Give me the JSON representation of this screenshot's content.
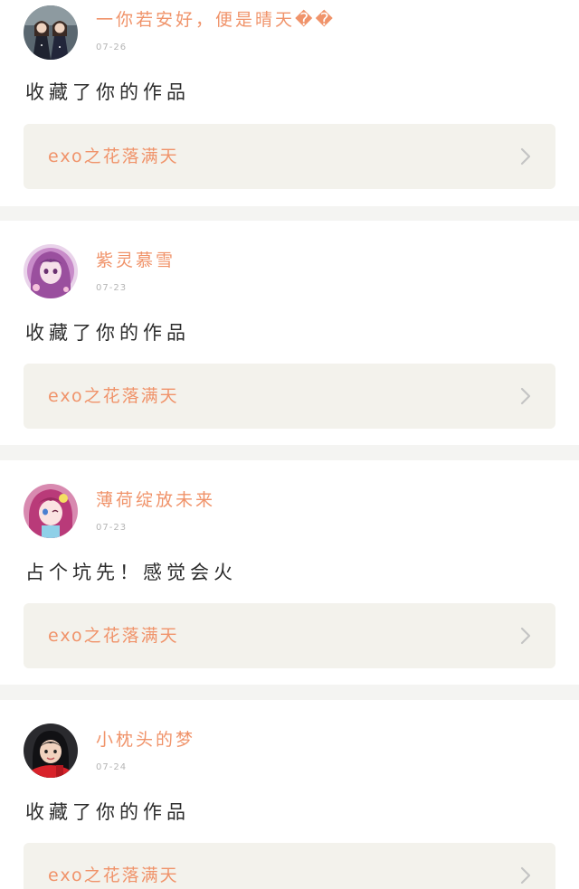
{
  "accent_color": "#f0936a",
  "feed": [
    {
      "username": "一你若安好，便是晴天��",
      "date": "07-26",
      "action_text": "收藏了你的作品",
      "work_title": "exo之花落满天",
      "avatar_icon": "two-girls-photo-avatar"
    },
    {
      "username": "紫灵慕雪",
      "date": "07-23",
      "action_text": "收藏了你的作品",
      "work_title": "exo之花落满天",
      "avatar_icon": "purple-anime-girl-avatar"
    },
    {
      "username": "薄荷绽放未来",
      "date": "07-23",
      "action_text": "占个坑先！感觉会火",
      "work_title": "exo之花落满天",
      "avatar_icon": "pink-anime-girl-avatar"
    },
    {
      "username": "小枕头的梦",
      "date": "07-24",
      "action_text": "收藏了你的作品",
      "work_title": "exo之花落满天",
      "avatar_icon": "girl-red-scarf-avatar"
    }
  ]
}
